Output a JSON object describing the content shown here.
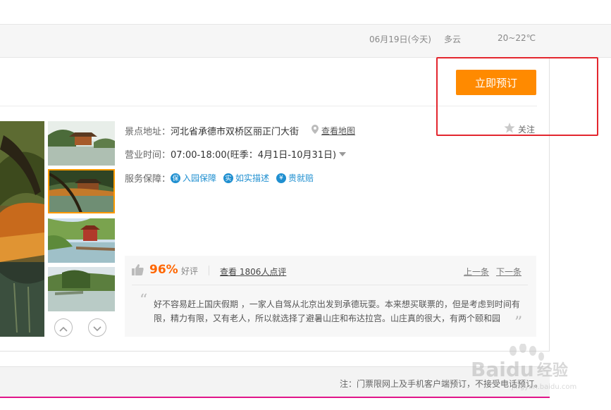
{
  "weather": {
    "date": "06月19日(今天)",
    "condition": "多云",
    "temperature": "20~22℃"
  },
  "booking": {
    "book_label": "立即预订",
    "follow_label": "关注"
  },
  "info": {
    "address_label": "景点地址：",
    "address_value": "河北省承德市双桥区丽正门大街",
    "map_link": "查看地图",
    "hours_label": "营业时间：",
    "hours_value": "07:00-18:00(旺季：4月1日-10月31日)",
    "service_label": "服务保障：",
    "guarantees": [
      {
        "badge": "保",
        "label": "入园保障"
      },
      {
        "badge": "实",
        "label": "如实描述"
      },
      {
        "badge": "¥",
        "label": "贵就赔"
      }
    ]
  },
  "review": {
    "percent": "96%",
    "good_label": "好评",
    "view_label": "查看 1806人点评",
    "prev_label": "上一条",
    "next_label": "下一条",
    "text": "好不容易赶上国庆假期 ，一家人自驾从北京出发到承德玩耍。本来想买联票的，但是考虑到时间有限，精力有限，又有老人，所以就选择了避暑山庄和布达拉宫。山庄真的很大，有两个颐和园"
  },
  "footer": {
    "note": "注：门票限网上及手机客户端预订，不接受电话预订。"
  },
  "watermark": {
    "brand": "Baidu",
    "sub": "经验",
    "url": "jingyan.baidu.com"
  },
  "colors": {
    "accent_orange": "#ff8a00",
    "percent_orange": "#ff6600",
    "highlight_red": "#e3262e",
    "link_blue": "#1f8fd0",
    "footer_pink": "#e0168a"
  }
}
